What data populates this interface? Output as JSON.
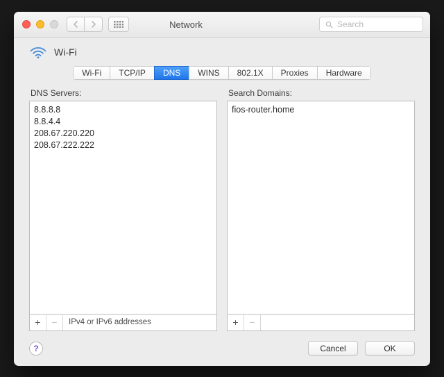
{
  "window": {
    "title": "Network"
  },
  "search": {
    "placeholder": "Search"
  },
  "header": {
    "connection_name": "Wi-Fi"
  },
  "tabs": [
    {
      "label": "Wi-Fi",
      "active": false
    },
    {
      "label": "TCP/IP",
      "active": false
    },
    {
      "label": "DNS",
      "active": true
    },
    {
      "label": "WINS",
      "active": false
    },
    {
      "label": "802.1X",
      "active": false
    },
    {
      "label": "Proxies",
      "active": false
    },
    {
      "label": "Hardware",
      "active": false
    }
  ],
  "dns": {
    "label": "DNS Servers:",
    "items": [
      "8.8.8.8",
      "8.8.4.4",
      "208.67.220.220",
      "208.67.222.222"
    ],
    "hint": "IPv4 or IPv6 addresses"
  },
  "search_domains": {
    "label": "Search Domains:",
    "items": [
      "fios-router.home"
    ]
  },
  "buttons": {
    "add": "+",
    "remove": "−",
    "help": "?",
    "cancel": "Cancel",
    "ok": "OK"
  }
}
